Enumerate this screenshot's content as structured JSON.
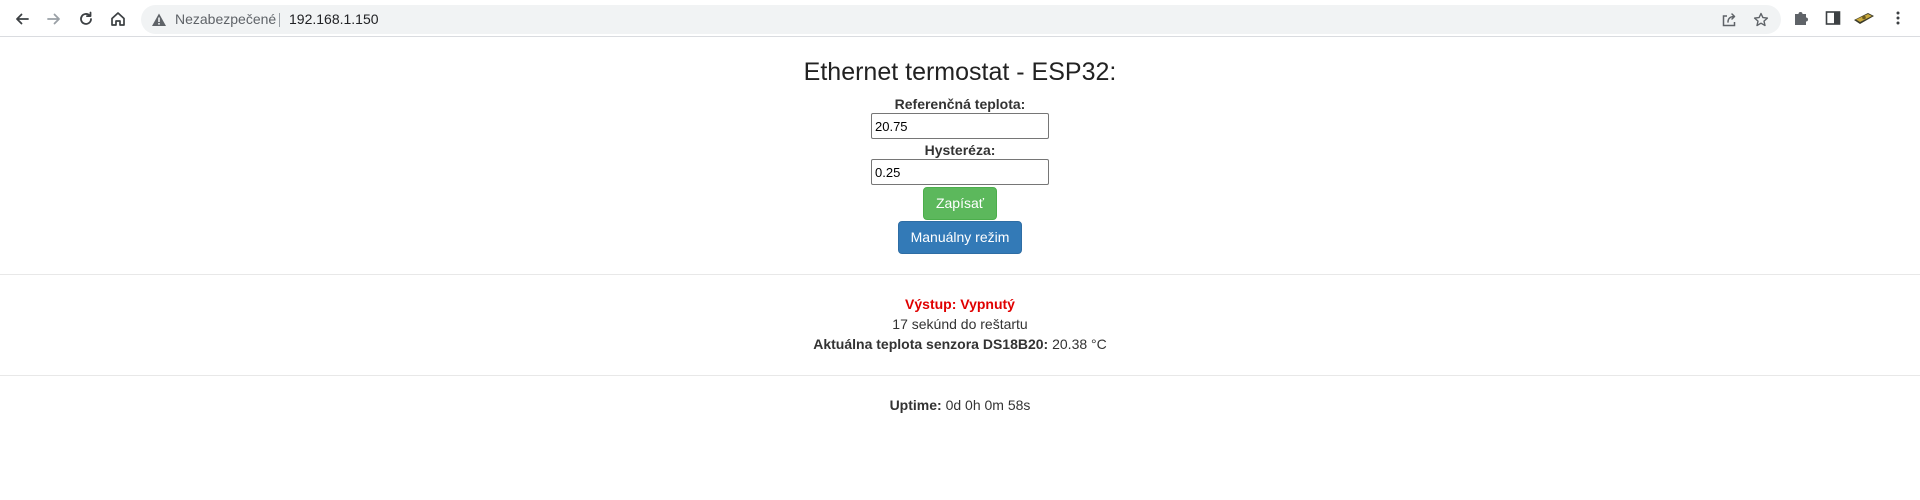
{
  "browser": {
    "insecure_label": "Nezabezpečené",
    "url": "192.168.1.150"
  },
  "page": {
    "title": "Ethernet termostat - ESP32:",
    "reference": {
      "label": "Referenčná teplota:",
      "value": "20.75"
    },
    "hysteresis": {
      "label": "Hysteréza:",
      "value": "0.25"
    },
    "save_button": "Zapísať",
    "manual_button": "Manuálny režim",
    "output_status": "Výstup: Vypnutý",
    "restart_countdown": "17 sekúnd do reštartu",
    "sensor": {
      "label": "Aktuálna teplota senzora DS18B20:",
      "value": "20.38 °C"
    },
    "uptime": {
      "label": "Uptime:",
      "value": "0d 0h 0m 58s"
    }
  },
  "colors": {
    "save_button": "#5cb85c",
    "manual_button": "#337ab7",
    "status_off": "#e00000"
  }
}
